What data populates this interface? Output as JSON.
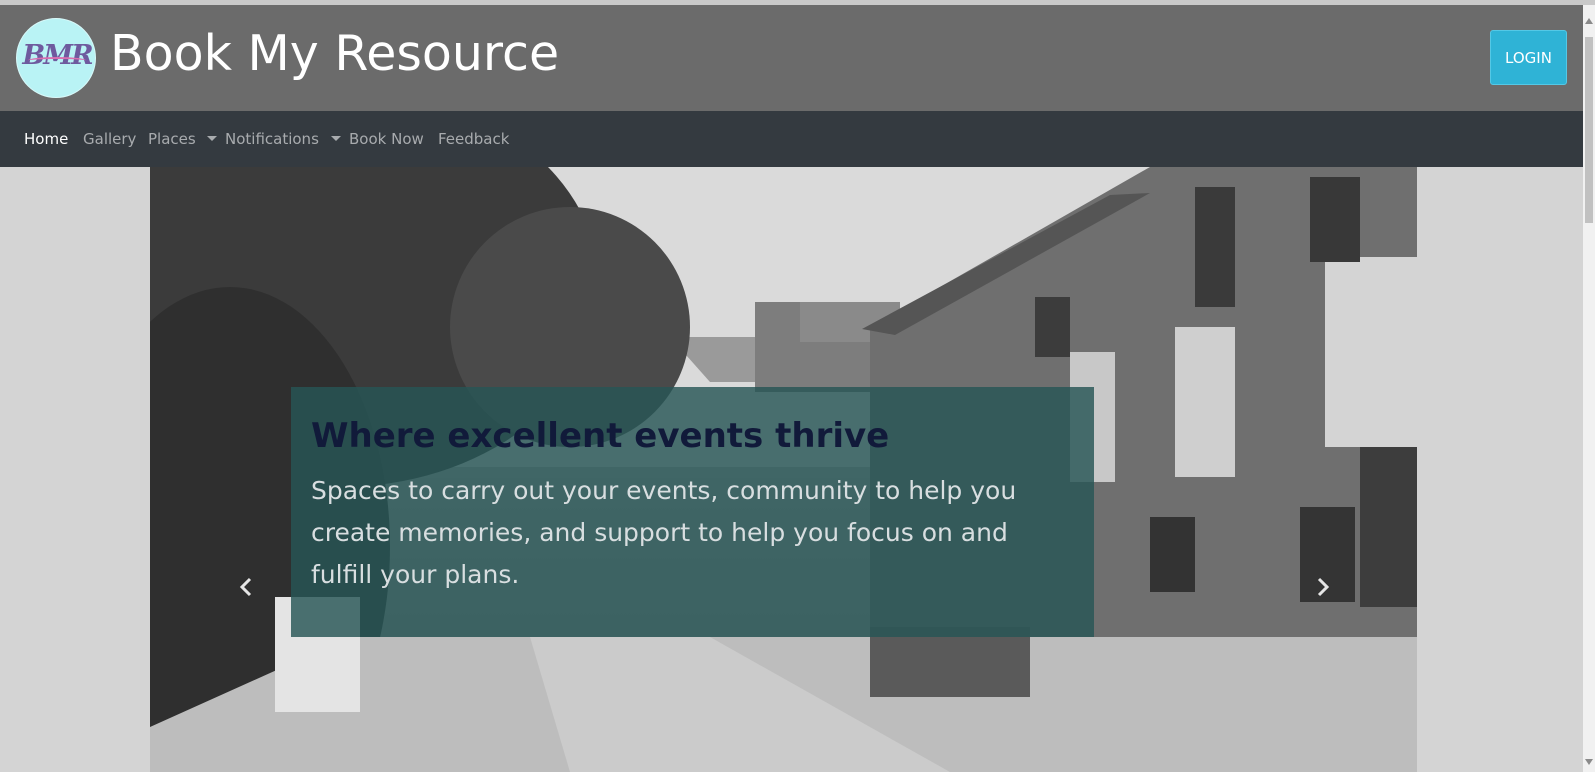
{
  "header": {
    "logo_text": "BMR",
    "title": "Book My Resource",
    "login_label": "LOGIN"
  },
  "nav": {
    "items": [
      {
        "label": "Home",
        "active": true
      },
      {
        "label": "Gallery"
      },
      {
        "label": "Places",
        "dropdown": true
      },
      {
        "label": "Notifications",
        "dropdown": true
      },
      {
        "label": "Book Now"
      },
      {
        "label": "Feedback"
      }
    ]
  },
  "carousel": {
    "caption_title": "Where excellent events thrive",
    "caption_text": "Spaces to carry out your events, community to help you create memories, and support to help you focus on and fulfill your plans.",
    "prev_icon": "chevron-left-icon",
    "next_icon": "chevron-right-icon"
  },
  "colors": {
    "header_bg": "#6b6b6b",
    "navbar_bg": "#343a40",
    "login_button": "#2fb3d6",
    "caption_bg": "#275656",
    "caption_title": "#111a3a"
  }
}
